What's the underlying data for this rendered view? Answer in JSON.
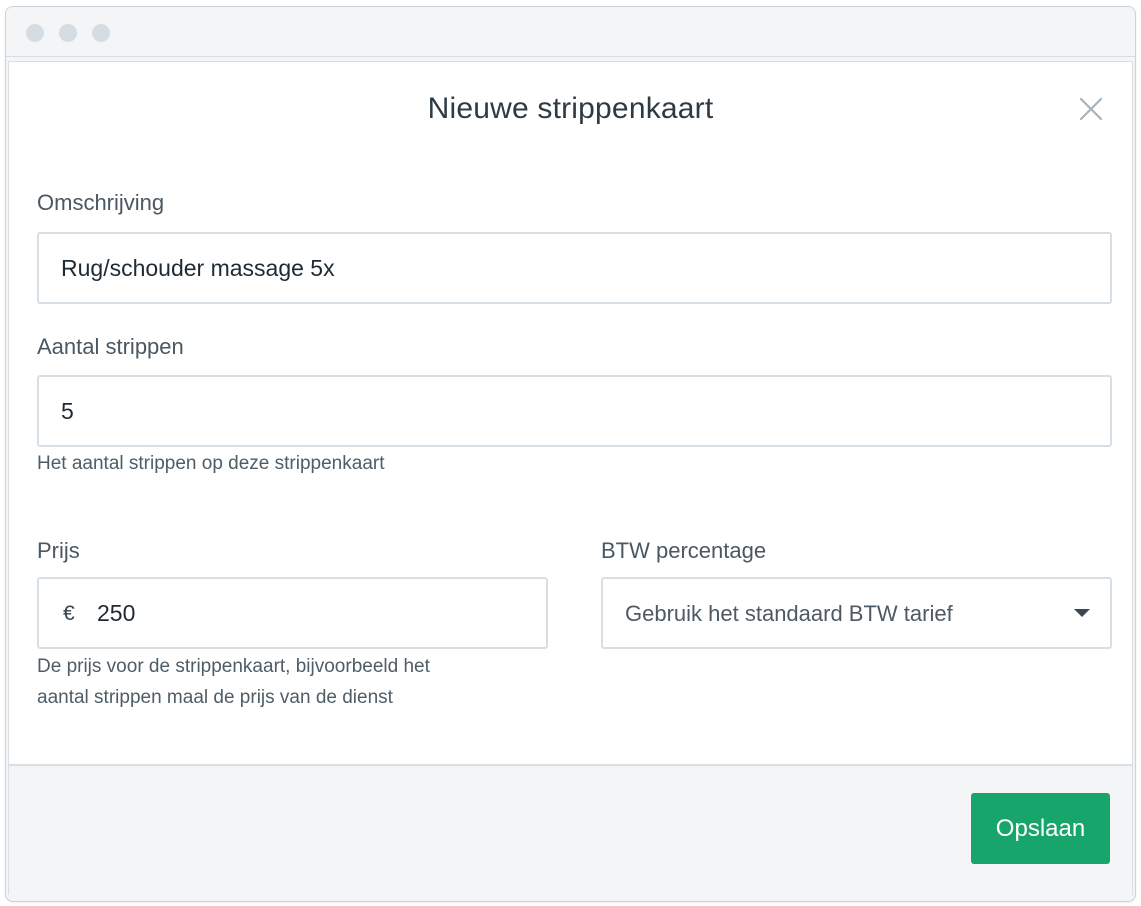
{
  "window": {
    "controls": [
      "window-dot",
      "window-dot",
      "window-dot"
    ]
  },
  "modal": {
    "title": "Nieuwe strippenkaart",
    "close_icon": "close-icon"
  },
  "form": {
    "description": {
      "label": "Omschrijving",
      "value": "Rug/schouder massage 5x"
    },
    "strips": {
      "label": "Aantal strippen",
      "value": "5",
      "help": "Het aantal strippen op deze strippenkaart"
    },
    "price": {
      "label": "Prijs",
      "currency": "€",
      "value": "250",
      "help_line1": "De prijs voor de strippenkaart, bijvoorbeeld het",
      "help_line2": "aantal strippen maal de prijs van de dienst"
    },
    "vat": {
      "label": "BTW percentage",
      "selected": "Gebruik het standaard BTW tarief",
      "caret_icon": "caret-down-icon"
    }
  },
  "footer": {
    "save_label": "Opslaan"
  },
  "colors": {
    "accent": "#17a56b",
    "border": "#d6dfe5",
    "text": "#2f3b44"
  }
}
